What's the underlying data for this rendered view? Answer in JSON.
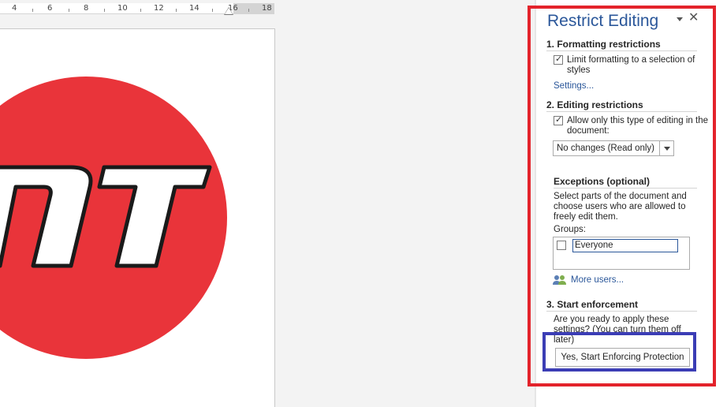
{
  "ruler": {
    "numbers": [
      "4",
      "6",
      "8",
      "10",
      "12",
      "14",
      "16",
      "18"
    ]
  },
  "document": {
    "logo_text": "NT",
    "logo_color": "#E9343A"
  },
  "pane": {
    "title": "Restrict Editing",
    "formatting": {
      "heading": "1. Formatting restrictions",
      "checkbox_label": "Limit formatting to a selection of styles",
      "checked": true,
      "settings_link": "Settings..."
    },
    "editing": {
      "heading": "2. Editing restrictions",
      "checkbox_label": "Allow only this type of editing in the document:",
      "checked": true,
      "dropdown_value": "No changes (Read only)"
    },
    "exceptions": {
      "heading": "Exceptions (optional)",
      "description": "Select parts of the document and choose users who are allowed to freely edit them.",
      "groups_label": "Groups:",
      "groups": [
        {
          "name": "Everyone",
          "checked": false
        }
      ],
      "more_users_link": "More users..."
    },
    "enforcement": {
      "heading": "3. Start enforcement",
      "description": "Are you ready to apply these settings? (You can turn them off later)",
      "button_label": "Yes, Start Enforcing Protection"
    }
  },
  "highlight_colors": {
    "pane_frame": "#E3232B",
    "button_frame": "#3B3DB5"
  }
}
